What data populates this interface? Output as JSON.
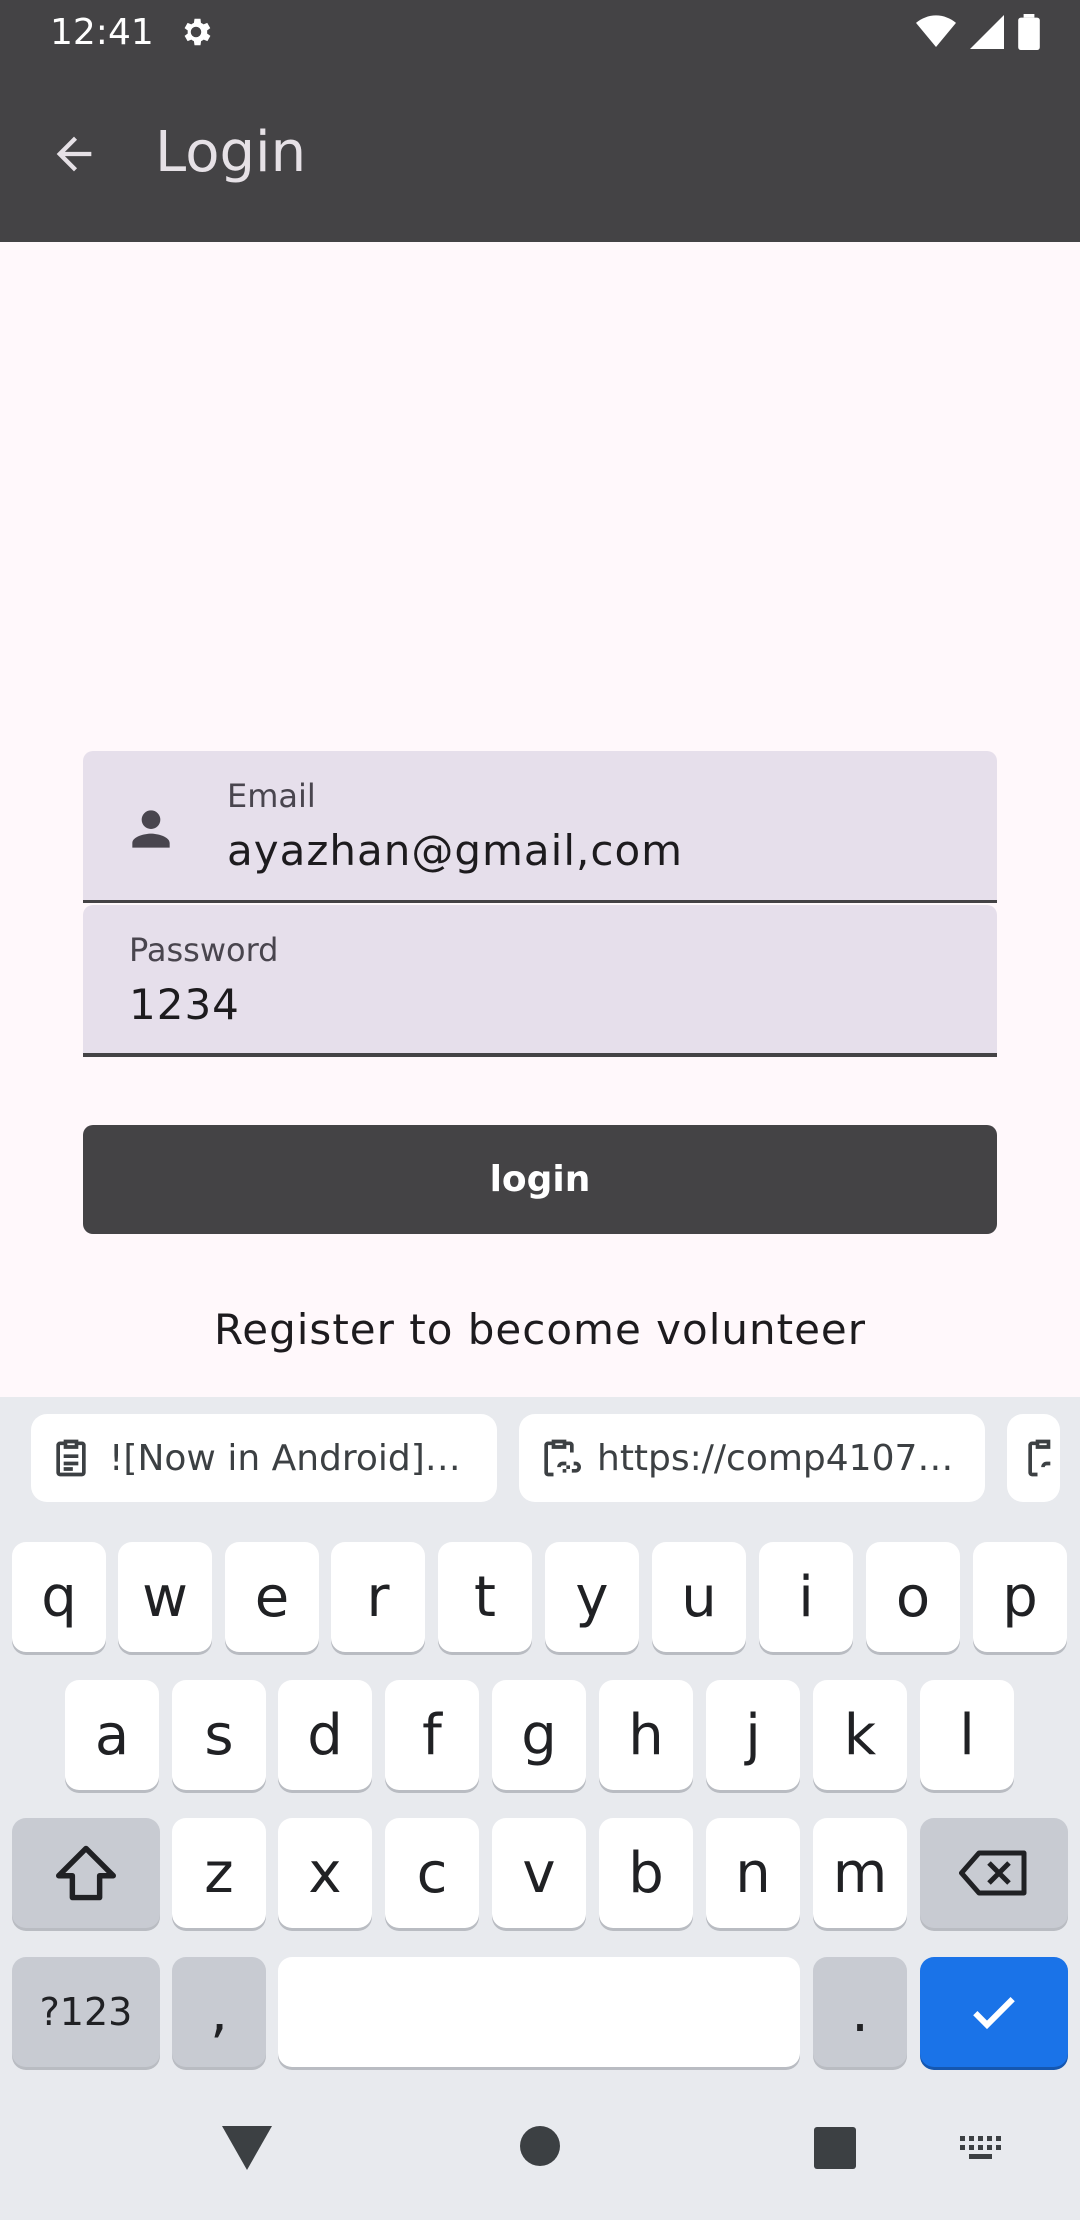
{
  "status_bar": {
    "time": "12:41"
  },
  "app_bar": {
    "title": "Login"
  },
  "form": {
    "email": {
      "label": "Email",
      "value": "ayazhan@gmail,com"
    },
    "password": {
      "label": "Password",
      "value": "1234"
    },
    "login_label": "login",
    "register_label": "Register to become volunteer"
  },
  "keyboard": {
    "clipboard": [
      "![Now in Android]…",
      "https://comp4107…"
    ],
    "row1": [
      "q",
      "w",
      "e",
      "r",
      "t",
      "y",
      "u",
      "i",
      "o",
      "p"
    ],
    "row2": [
      "a",
      "s",
      "d",
      "f",
      "g",
      "h",
      "j",
      "k",
      "l"
    ],
    "row3": [
      "z",
      "x",
      "c",
      "v",
      "b",
      "n",
      "m"
    ],
    "symbols_label": "?123",
    "comma": ",",
    "period": "."
  },
  "colors": {
    "bar": "#444345",
    "field": "#e6dfeb",
    "enter": "#1a73e8"
  }
}
